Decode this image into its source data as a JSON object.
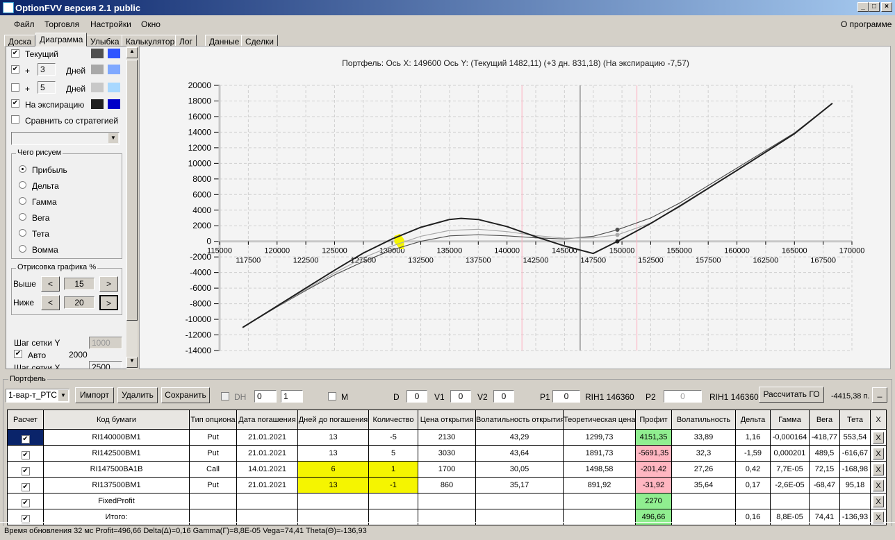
{
  "window": {
    "title": "OptionFVV версия 2.1 public",
    "min": "_",
    "max": "□",
    "close": "×"
  },
  "menu": [
    "Файл",
    "Торговля",
    "Настройки",
    "Окно"
  ],
  "menu_right": "О программе",
  "tabs": [
    "Доска",
    "Диаграмма",
    "Улыбка",
    "Калькулятор",
    "Лог",
    "Данные",
    "Сделки"
  ],
  "active_tab": "Диаграмма",
  "left": {
    "current": {
      "label": "Текущий",
      "checked": true,
      "colors": [
        "#505050",
        "#2f54ff"
      ]
    },
    "plus1": {
      "plus": "+",
      "days": "3",
      "unit": "Дней",
      "checked": true,
      "colors": [
        "#a8a8a8",
        "#7fa8ff"
      ]
    },
    "plus2": {
      "plus": "+",
      "days": "5",
      "unit": "Дней",
      "checked": false,
      "colors": [
        "#c8c8c8",
        "#a8d8ff"
      ]
    },
    "expiry": {
      "label": "На экспирацию",
      "checked": true,
      "colors": [
        "#202020",
        "#0000c8"
      ]
    },
    "compare": {
      "label": "Сравнить со стратегией",
      "checked": false
    },
    "what_group": "Чего рисуем",
    "what": [
      "Прибыль",
      "Дельта",
      "Гамма",
      "Вега",
      "Тета",
      "Вомма"
    ],
    "what_selected": "Прибыль",
    "render_group": "Отрисовка графика %",
    "above": {
      "label": "Выше",
      "value": "15",
      "prev": "<",
      "next": ">"
    },
    "below": {
      "label": "Ниже",
      "value": "20",
      "prev": "<",
      "next": ">"
    },
    "grid_y": {
      "label": "Шаг сетки Y",
      "value": "1000"
    },
    "auto": {
      "label": "Авто",
      "checked": true,
      "value": "2000"
    },
    "grid_x": {
      "label": "Шаг сетки X",
      "value": "2500"
    }
  },
  "chart_data": {
    "type": "line",
    "title": "Портфель: Ось X: 149600 Ось Y:  (Текущий 1482,11)  (+3 дн. 831,18)  (На экспирацию -7,57)",
    "xlim": [
      115000,
      170000
    ],
    "ylim": [
      -14000,
      20000
    ],
    "grid": true,
    "x_ticks_top": [
      115000,
      120000,
      125000,
      130000,
      135000,
      140000,
      145000,
      150000,
      155000,
      160000,
      165000,
      170000
    ],
    "x_ticks_bottom": [
      117500,
      122500,
      127500,
      132500,
      137500,
      142500,
      147500,
      152500,
      157500,
      162500,
      167500
    ],
    "y_ticks": [
      20000,
      18000,
      16000,
      14000,
      12000,
      10000,
      8000,
      6000,
      4000,
      2000,
      0,
      -2000,
      -4000,
      -6000,
      -8000,
      -10000,
      -12000,
      -14000
    ],
    "current_price": 146360,
    "cursor_x": 149600,
    "bounds": [
      141300,
      151300
    ],
    "series": [
      {
        "name": "Текущий",
        "color": "#505050",
        "width": 1.2,
        "x": [
          117000,
          120000,
          122500,
          125000,
          127500,
          130000,
          132500,
          135000,
          137500,
          140000,
          142500,
          145000,
          147500,
          149600,
          152500,
          155000,
          160000,
          165000,
          168300
        ],
        "y": [
          -11050,
          -8400,
          -6300,
          -4300,
          -2600,
          -1100,
          0,
          700,
          850,
          700,
          450,
          300,
          650,
          1482,
          3000,
          4900,
          9400,
          13900,
          17700
        ]
      },
      {
        "name": "+3 дн.",
        "color": "#a8a8a8",
        "width": 1.2,
        "x": [
          117000,
          120000,
          122500,
          125000,
          127500,
          130000,
          132500,
          135000,
          137500,
          140000,
          142500,
          145000,
          147500,
          149600,
          152500,
          155000,
          160000,
          165000,
          168300
        ],
        "y": [
          -11050,
          -8350,
          -6200,
          -4050,
          -2100,
          -600,
          650,
          1400,
          1550,
          1250,
          750,
          400,
          450,
          831,
          2350,
          4400,
          9100,
          13800,
          17700
        ]
      },
      {
        "name": "На экспирацию",
        "color": "#202020",
        "width": 2,
        "x": [
          117000,
          120000,
          122500,
          125000,
          127500,
          130000,
          132500,
          135000,
          136000,
          137500,
          140000,
          142500,
          145000,
          147500,
          149600,
          152500,
          155000,
          160000,
          165000,
          168300
        ],
        "y": [
          -11050,
          -8300,
          -6000,
          -3700,
          -1500,
          300,
          1800,
          2800,
          2950,
          2800,
          1900,
          600,
          -600,
          -1560,
          -7.57,
          2300,
          4500,
          9100,
          13800,
          17700
        ]
      }
    ]
  },
  "portfolio": {
    "caption": "Портфель",
    "strategy": "1-вар-т_РТС",
    "import": "Импорт",
    "delete": "Удалить",
    "save": "Сохранить",
    "dh": "DH",
    "spin1": "0",
    "spin2": "1",
    "m": "M",
    "d_label": "D",
    "d": "0",
    "v1_label": "V1",
    "v1": "0",
    "v2_label": "V2",
    "v2": "0",
    "p1_label": "P1",
    "p1": "0",
    "p1_info": "RIH1 146360",
    "p2_label": "P2",
    "p2": "0",
    "p2_info": "RIH1 146360",
    "calc_go": "Рассчитать ГО",
    "go_value": "-4415,38 п.",
    "collapse": "_",
    "columns": [
      "Расчет",
      "Код бумаги",
      "Тип опциона",
      "Дата погашения",
      "Дней до погашения",
      "Количество",
      "Цена открытия",
      "Волатильность открытия",
      "Теоретическая цена",
      "Профит",
      "Волатильность",
      "Дельта",
      "Гамма",
      "Вега",
      "Тета",
      "X"
    ],
    "rows": [
      {
        "code": "RI140000BM1",
        "type": "Put",
        "date": "21.01.2021",
        "days": "13",
        "qty": "-5",
        "open": "2130",
        "vol_open": "43,29",
        "theo": "1299,73",
        "profit": "4151,35",
        "vol": "33,89",
        "delta": "1,16",
        "gamma": "-0,000164",
        "vega": "-418,77",
        "theta": "553,54",
        "x": "X",
        "profit_state": "pos",
        "hl": false,
        "selected": true
      },
      {
        "code": "RI142500BM1",
        "type": "Put",
        "date": "21.01.2021",
        "days": "13",
        "qty": "5",
        "open": "3030",
        "vol_open": "43,64",
        "theo": "1891,73",
        "profit": "-5691,35",
        "vol": "32,3",
        "delta": "-1,59",
        "gamma": "0,000201",
        "vega": "489,5",
        "theta": "-616,67",
        "x": "X",
        "profit_state": "neg",
        "hl": false
      },
      {
        "code": "RI147500BA1B",
        "type": "Call",
        "date": "14.01.2021",
        "days": "6",
        "qty": "1",
        "open": "1700",
        "vol_open": "30,05",
        "theo": "1498,58",
        "profit": "-201,42",
        "vol": "27,26",
        "delta": "0,42",
        "gamma": "7,7E-05",
        "vega": "72,15",
        "theta": "-168,98",
        "x": "X",
        "profit_state": "neg",
        "hl": true
      },
      {
        "code": "RI137500BM1",
        "type": "Put",
        "date": "21.01.2021",
        "days": "13",
        "qty": "-1",
        "open": "860",
        "vol_open": "35,17",
        "theo": "891,92",
        "profit": "-31,92",
        "vol": "35,64",
        "delta": "0,17",
        "gamma": "-2,6E-05",
        "vega": "-68,47",
        "theta": "95,18",
        "x": "X",
        "profit_state": "neg",
        "hl": true
      },
      {
        "code": "FixedProfit",
        "type": "",
        "date": "",
        "days": "",
        "qty": "",
        "open": "",
        "vol_open": "",
        "theo": "",
        "profit": "2270",
        "vol": "",
        "delta": "",
        "gamma": "",
        "vega": "",
        "theta": "",
        "x": "X",
        "profit_state": "pos",
        "hl": false
      },
      {
        "code": "Итого:",
        "type": "",
        "date": "",
        "days": "",
        "qty": "",
        "open": "",
        "vol_open": "",
        "theo": "",
        "profit": "496,66",
        "vol": "",
        "delta": "0,16",
        "gamma": "8,8E-05",
        "vega": "74,41",
        "theta": "-136,93",
        "x": "X",
        "profit_state": "pos",
        "hl": false
      }
    ]
  },
  "status": "Время обновления 32 мс  Profit=496,66 Delta(Δ)=0,16 Gamma(Γ)=8,8E-05 Vega=74,41 Theta(Θ)=-136,93"
}
